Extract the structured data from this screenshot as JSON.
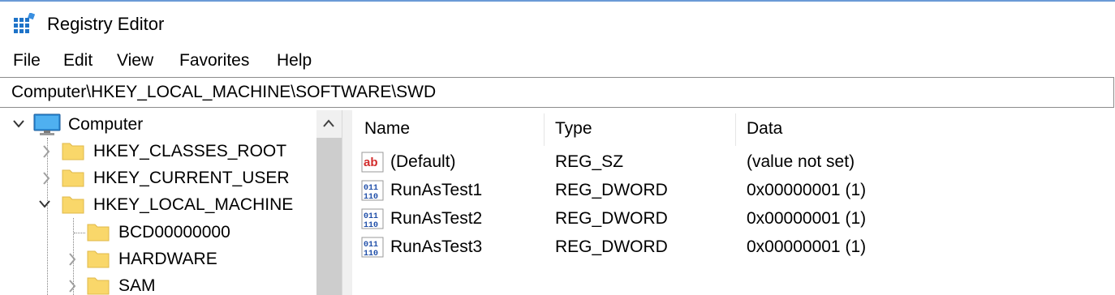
{
  "window": {
    "title": "Registry Editor"
  },
  "menu": [
    "File",
    "Edit",
    "View",
    "Favorites",
    "Help"
  ],
  "address": {
    "path": "Computer\\HKEY_LOCAL_MACHINE\\SOFTWARE\\SWD"
  },
  "tree": {
    "root": {
      "label": "Computer",
      "icon": "computer-icon",
      "expanded": true
    },
    "items": [
      {
        "label": "HKEY_CLASSES_ROOT",
        "level": 1,
        "expander": "collapsed"
      },
      {
        "label": "HKEY_CURRENT_USER",
        "level": 1,
        "expander": "collapsed"
      },
      {
        "label": "HKEY_LOCAL_MACHINE",
        "level": 1,
        "expander": "expanded"
      },
      {
        "label": "BCD00000000",
        "level": 2,
        "expander": "none"
      },
      {
        "label": "HARDWARE",
        "level": 2,
        "expander": "collapsed"
      },
      {
        "label": "SAM",
        "level": 2,
        "expander": "collapsed"
      }
    ]
  },
  "list": {
    "columns": [
      "Name",
      "Type",
      "Data"
    ],
    "rows": [
      {
        "name": "(Default)",
        "type": "REG_SZ",
        "data": "(value not set)",
        "icon": "string-value-icon"
      },
      {
        "name": "RunAsTest1",
        "type": "REG_DWORD",
        "data": "0x00000001 (1)",
        "icon": "binary-value-icon"
      },
      {
        "name": "RunAsTest2",
        "type": "REG_DWORD",
        "data": "0x00000001 (1)",
        "icon": "binary-value-icon"
      },
      {
        "name": "RunAsTest3",
        "type": "REG_DWORD",
        "data": "0x00000001 (1)",
        "icon": "binary-value-icon"
      }
    ]
  },
  "colors": {
    "folder": "#f9d76a",
    "accent": "#1e73c8",
    "string_icon": "#d22c2c",
    "binary_icon": "#1f4ea8"
  }
}
